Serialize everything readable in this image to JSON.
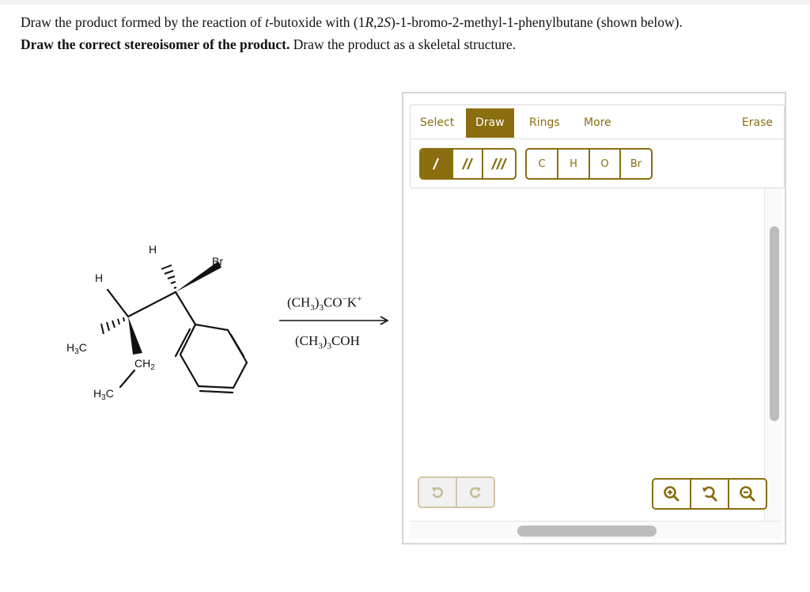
{
  "question": {
    "line1_pre": "Draw the product formed by the reaction of ",
    "line1_italic": "t",
    "line1_post": "-butoxide with (1R,2S)-1-bromo-2-methyl-1-phenylbutane (shown below).",
    "line2_bold": "Draw the correct stereoisomer of the product.",
    "line2_rest": " Draw the product as a skeletal structure."
  },
  "molecule": {
    "labels": {
      "h_top": "H",
      "br": "Br",
      "h_left": "H",
      "h3c_left": "H3C",
      "ch2": "CH2",
      "h3c_bottom": "H3C"
    }
  },
  "reaction": {
    "reagent_above": "(CH3)3CO−K+",
    "solvent_below": "(CH3)3COH"
  },
  "editor": {
    "tabs": [
      {
        "label": "Select",
        "active": false
      },
      {
        "label": "Draw",
        "active": true
      },
      {
        "label": "Rings",
        "active": false
      },
      {
        "label": "More",
        "active": false
      }
    ],
    "erase_label": "Erase",
    "bond_buttons": [
      {
        "icon": "single-bond-icon",
        "active": true
      },
      {
        "icon": "double-bond-icon",
        "active": false
      },
      {
        "icon": "triple-bond-icon",
        "active": false
      }
    ],
    "atom_buttons": [
      "C",
      "H",
      "O",
      "Br"
    ],
    "undo_icon": "undo-icon",
    "redo_icon": "redo-icon",
    "zoom_buttons": [
      "zoom-in-icon",
      "zoom-reset-icon",
      "zoom-out-icon"
    ],
    "accent_color": "#8a6e0f"
  }
}
